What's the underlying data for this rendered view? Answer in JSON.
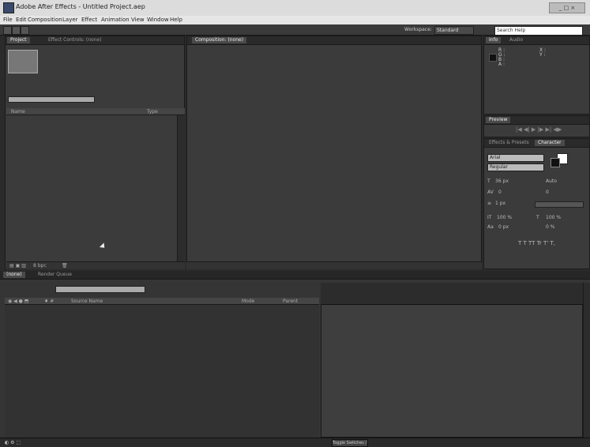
{
  "window": {
    "title": "Adobe After Effects - Untitled Project.aep",
    "controls": "_ □ ×"
  },
  "menu": [
    "File",
    "Edit",
    "Composition",
    "Layer",
    "Effect",
    "Animation",
    "View",
    "Window",
    "Help"
  ],
  "toolbar": {
    "workspace_label": "Workspace:",
    "workspace_value": "Standard",
    "search_placeholder": "Search Help"
  },
  "project_panel": {
    "tabs": [
      "Project",
      "Effect Controls: (none)"
    ],
    "columns": {
      "name": "Name",
      "type": "Type"
    },
    "bpc": "8 bpc"
  },
  "composition_panel": {
    "tab": "Composition: (none)"
  },
  "info_panel": {
    "tabs": [
      "Info",
      "Audio"
    ],
    "labels": {
      "r": "R :",
      "g": "G :",
      "b": "B :",
      "a": "A :",
      "x": "X :",
      "y": "Y :"
    }
  },
  "preview_panel": {
    "tab": "Preview"
  },
  "character_panel": {
    "tabs": [
      "Effects & Presets",
      "Character"
    ],
    "font": "Arial",
    "style": "Regular",
    "size": "36 px",
    "leading": "Auto",
    "kerning": "0",
    "tracking": "0",
    "stroke": "1 px",
    "v_scale": "100 %",
    "h_scale": "100 %",
    "baseline": "0 px",
    "tsume": "0 %",
    "styles": "T T TT Tr T' T,"
  },
  "timeline_panel": {
    "tabs": [
      "(none)",
      "Render Queue"
    ],
    "columns": {
      "source": "Source Name",
      "mode": "Mode",
      "parent": "Parent"
    },
    "footer": "Toggle Switches / Modes"
  },
  "colors": {
    "bg": "#2b2b2b",
    "panel": "#3b3b3b",
    "accent": "#dcdcdc"
  }
}
